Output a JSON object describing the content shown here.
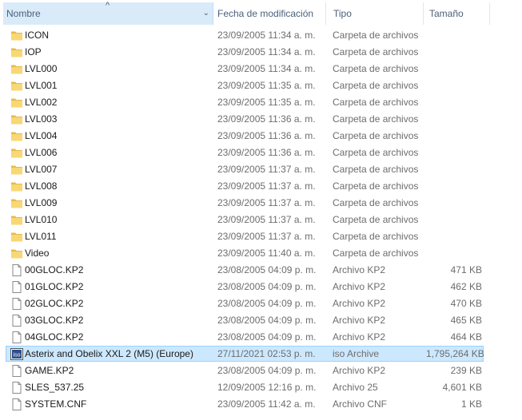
{
  "columns": {
    "name": "Nombre",
    "date": "Fecha de modificación",
    "type": "Tipo",
    "size": "Tamaño"
  },
  "rows": [
    {
      "name": "ICON",
      "date": "23/09/2005 11:34 a. m.",
      "type": "Carpeta de archivos",
      "size": "",
      "icon": "folder-icon"
    },
    {
      "name": "IOP",
      "date": "23/09/2005 11:34 a. m.",
      "type": "Carpeta de archivos",
      "size": "",
      "icon": "folder-icon"
    },
    {
      "name": "LVL000",
      "date": "23/09/2005 11:34 a. m.",
      "type": "Carpeta de archivos",
      "size": "",
      "icon": "folder-icon"
    },
    {
      "name": "LVL001",
      "date": "23/09/2005 11:35 a. m.",
      "type": "Carpeta de archivos",
      "size": "",
      "icon": "folder-icon"
    },
    {
      "name": "LVL002",
      "date": "23/09/2005 11:35 a. m.",
      "type": "Carpeta de archivos",
      "size": "",
      "icon": "folder-icon"
    },
    {
      "name": "LVL003",
      "date": "23/09/2005 11:36 a. m.",
      "type": "Carpeta de archivos",
      "size": "",
      "icon": "folder-icon"
    },
    {
      "name": "LVL004",
      "date": "23/09/2005 11:36 a. m.",
      "type": "Carpeta de archivos",
      "size": "",
      "icon": "folder-icon"
    },
    {
      "name": "LVL006",
      "date": "23/09/2005 11:36 a. m.",
      "type": "Carpeta de archivos",
      "size": "",
      "icon": "folder-icon"
    },
    {
      "name": "LVL007",
      "date": "23/09/2005 11:37 a. m.",
      "type": "Carpeta de archivos",
      "size": "",
      "icon": "folder-icon"
    },
    {
      "name": "LVL008",
      "date": "23/09/2005 11:37 a. m.",
      "type": "Carpeta de archivos",
      "size": "",
      "icon": "folder-icon"
    },
    {
      "name": "LVL009",
      "date": "23/09/2005 11:37 a. m.",
      "type": "Carpeta de archivos",
      "size": "",
      "icon": "folder-icon"
    },
    {
      "name": "LVL010",
      "date": "23/09/2005 11:37 a. m.",
      "type": "Carpeta de archivos",
      "size": "",
      "icon": "folder-icon"
    },
    {
      "name": "LVL011",
      "date": "23/09/2005 11:37 a. m.",
      "type": "Carpeta de archivos",
      "size": "",
      "icon": "folder-icon"
    },
    {
      "name": "Video",
      "date": "23/09/2005 11:40 a. m.",
      "type": "Carpeta de archivos",
      "size": "",
      "icon": "folder-icon"
    },
    {
      "name": "00GLOC.KP2",
      "date": "23/08/2005 04:09 p. m.",
      "type": "Archivo KP2",
      "size": "471 KB",
      "icon": "file-icon"
    },
    {
      "name": "01GLOC.KP2",
      "date": "23/08/2005 04:09 p. m.",
      "type": "Archivo KP2",
      "size": "462 KB",
      "icon": "file-icon"
    },
    {
      "name": "02GLOC.KP2",
      "date": "23/08/2005 04:09 p. m.",
      "type": "Archivo KP2",
      "size": "470 KB",
      "icon": "file-icon"
    },
    {
      "name": "03GLOC.KP2",
      "date": "23/08/2005 04:09 p. m.",
      "type": "Archivo KP2",
      "size": "465 KB",
      "icon": "file-icon"
    },
    {
      "name": "04GLOC.KP2",
      "date": "23/08/2005 04:09 p. m.",
      "type": "Archivo KP2",
      "size": "464 KB",
      "icon": "file-icon"
    },
    {
      "name": "Asterix and Obelix XXL 2 (M5) (Europe)",
      "date": "27/11/2021 02:53 p. m.",
      "type": "iso Archive",
      "size": "1,795,264 KB",
      "icon": "iso-icon",
      "selected": true
    },
    {
      "name": "GAME.KP2",
      "date": "23/08/2005 04:09 p. m.",
      "type": "Archivo KP2",
      "size": "239 KB",
      "icon": "file-icon"
    },
    {
      "name": "SLES_537.25",
      "date": "12/09/2005 12:16 p. m.",
      "type": "Archivo 25",
      "size": "4,601 KB",
      "icon": "file-icon"
    },
    {
      "name": "SYSTEM.CNF",
      "date": "23/09/2005 11:42 a. m.",
      "type": "Archivo CNF",
      "size": "1 KB",
      "icon": "file-icon"
    }
  ],
  "colors": {
    "header_text": "#4c607a",
    "header_sorted_bg": "#d9ebf9",
    "selection_bg": "#cce8ff",
    "selection_border": "#99d1ff",
    "folder": "#f8d775"
  }
}
